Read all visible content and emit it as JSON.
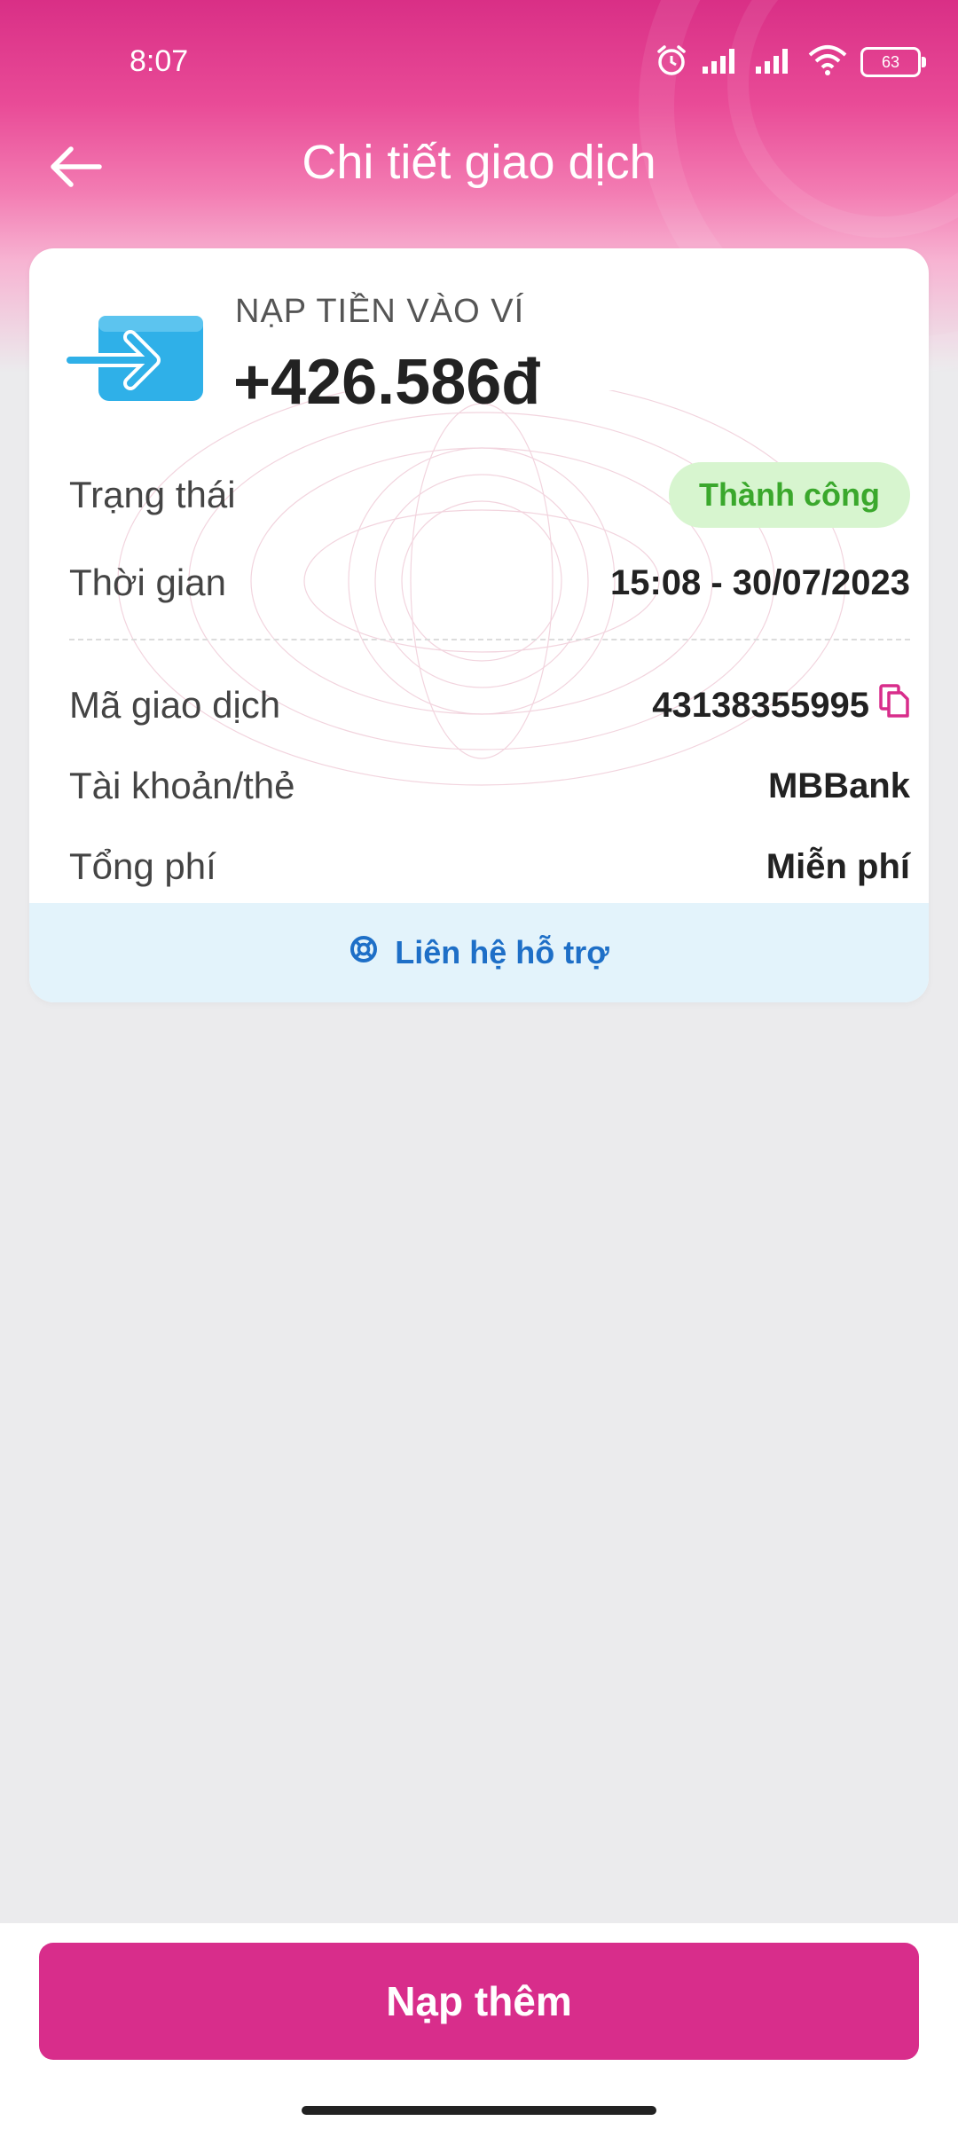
{
  "status_bar": {
    "time": "8:07",
    "battery": "63",
    "icons": [
      "alarm-icon",
      "signal-icon",
      "signal-icon",
      "wifi-icon",
      "battery-icon"
    ]
  },
  "header": {
    "title": "Chi tiết giao dịch",
    "back_icon": "arrow-left-icon"
  },
  "transaction": {
    "icon": "wallet-deposit-icon",
    "type": "NẠP TIỀN VÀO VÍ",
    "amount": "+426.586đ",
    "rows": [
      {
        "label": "Trạng thái",
        "value": "Thành công"
      },
      {
        "label": "Thời gian",
        "value": "15:08 - 30/07/2023"
      },
      {
        "label": "Mã giao dịch",
        "value": "43138355995"
      },
      {
        "label": "Tài khoản/thẻ",
        "value": "MBBank"
      },
      {
        "label": "Tổng phí",
        "value": "Miễn phí"
      }
    ]
  },
  "support": {
    "label": "Liên hệ hỗ trợ",
    "icon": "lifebuoy-icon"
  },
  "footer": {
    "primary_button": "Nạp thêm"
  },
  "colors": {
    "brand_pink": "#d82d8b",
    "success_bg": "#d7f5cf",
    "success_text": "#3aa82c",
    "support_bg": "#e3f3fb",
    "support_text": "#1e6fc7",
    "wallet_blue": "#2fb0e8"
  }
}
